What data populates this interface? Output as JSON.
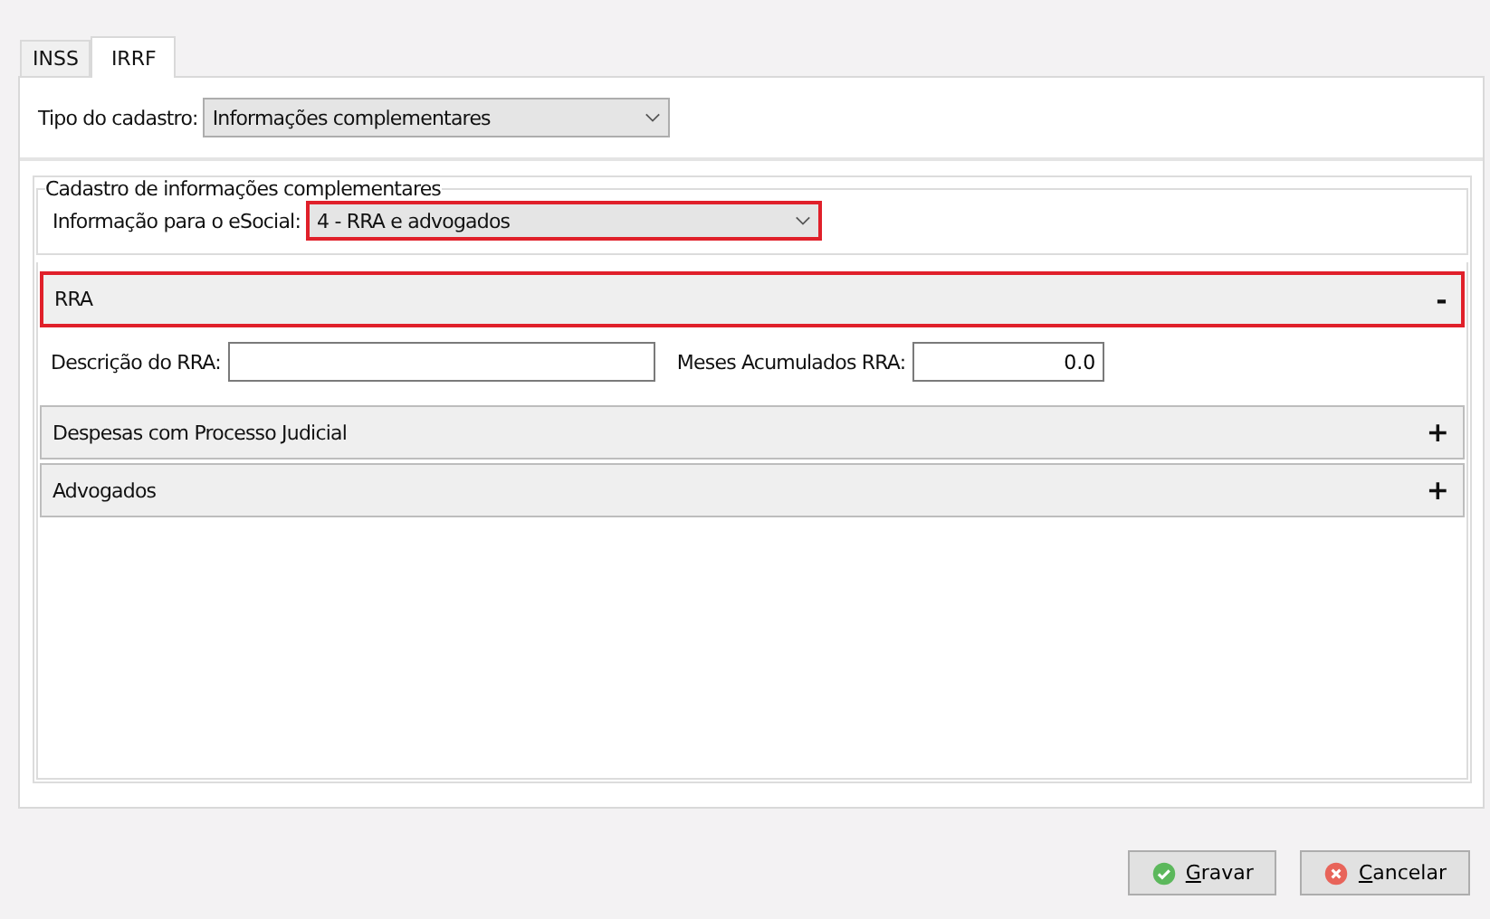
{
  "tabs": [
    {
      "label": "INSS",
      "selected": false
    },
    {
      "label": "IRRF",
      "selected": true
    }
  ],
  "tipo_do_cadastro": {
    "label": "Tipo do cadastro:",
    "value": "Informações complementares",
    "highlighted": false
  },
  "group": {
    "legend": "Cadastro de informações complementares",
    "label": "Informação para o eSocial:",
    "value": "4 - RRA e advogados",
    "highlighted": true
  },
  "sections": [
    {
      "title": "RRA",
      "toggle": "-",
      "highlighted": true,
      "fields": [
        {
          "label": "Descrição do RRA:"
        },
        {
          "label": "Meses Acumulados RRA:",
          "value": "0.0"
        }
      ]
    },
    {
      "title": "Despesas com Processo Judicial",
      "toggle": "+",
      "highlighted": false
    },
    {
      "title": "Advogados",
      "toggle": "+",
      "highlighted": false
    }
  ],
  "buttons": [
    {
      "label": "Gravar",
      "kind": "ok"
    },
    {
      "label": "Cancelar",
      "kind": "cancel"
    }
  ]
}
